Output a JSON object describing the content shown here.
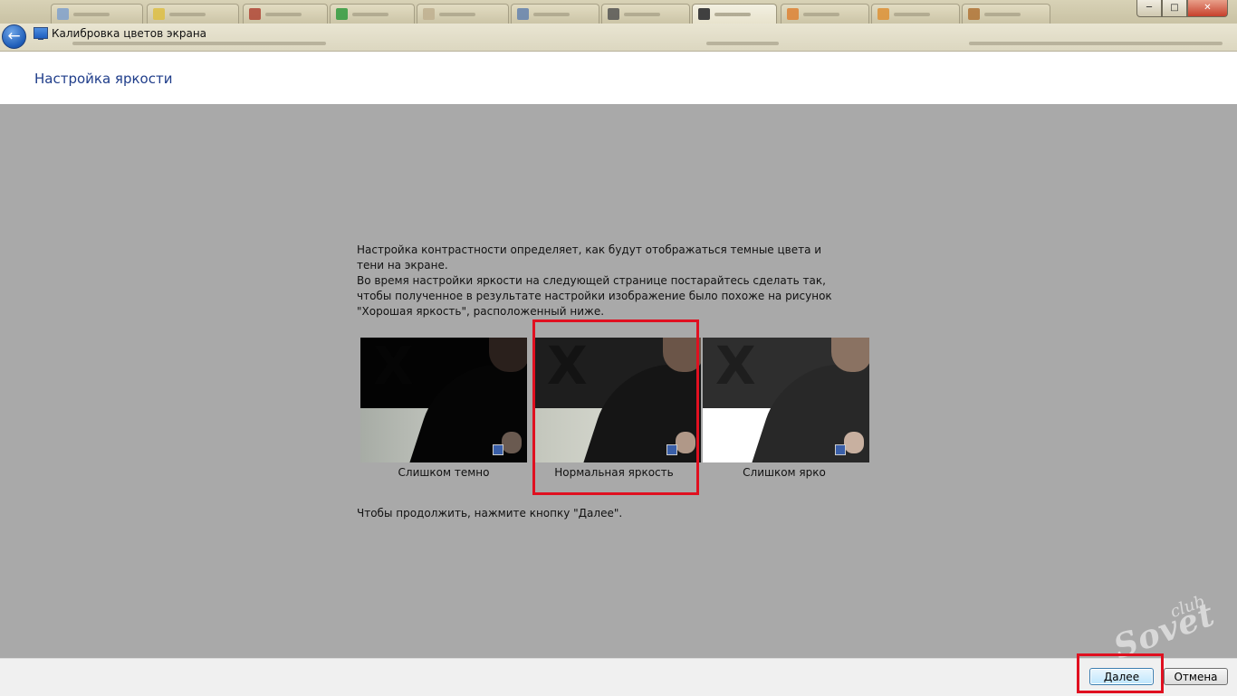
{
  "window": {
    "app_title": "Калибровка цветов экрана",
    "min_glyph": "─",
    "max_glyph": "□",
    "close_glyph": "✕",
    "back_glyph": "←"
  },
  "header": {
    "page_title": "Настройка яркости"
  },
  "content": {
    "paragraph_1": "Настройка контрастности определяет, как будут отображаться темные цвета и тени на экране.",
    "paragraph_2": "Во время настройки яркости на следующей странице постарайтесь сделать так, чтобы полученное в результате настройки изображение было похоже на рисунок \"Хорошая яркость\", расположенный ниже.",
    "continue_text": "Чтобы продолжить, нажмите кнопку \"Далее\"."
  },
  "samples": [
    {
      "caption": "Слишком темно",
      "x_glyph": "X"
    },
    {
      "caption": "Нормальная яркость",
      "x_glyph": "X"
    },
    {
      "caption": "Слишком ярко",
      "x_glyph": "X"
    }
  ],
  "footer": {
    "next_label": "Далее",
    "cancel_label": "Отмена"
  },
  "watermark": {
    "club": "club",
    "sovet": "Sovet"
  },
  "colors": {
    "page_background": "#a9a9a9",
    "title_blue": "#1f3d8a",
    "highlight_red": "#e01020"
  }
}
